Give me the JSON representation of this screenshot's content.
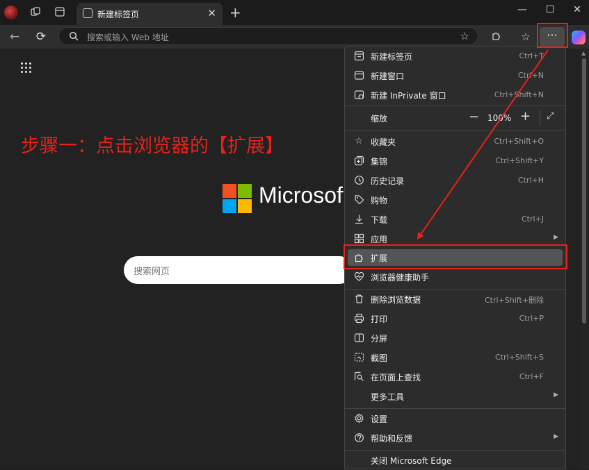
{
  "browser": {
    "tab_title": "新建标签页",
    "address_placeholder": "搜索或输入 Web 地址"
  },
  "page": {
    "annotation": "步骤一：点击浏览器的【扩展】",
    "brand": "Microsoft",
    "search_placeholder": "搜索网页"
  },
  "menu": {
    "items": [
      {
        "label": "新建标签页",
        "shortcut": "Ctrl+T",
        "icon": "new-tab-icon"
      },
      {
        "label": "新建窗口",
        "shortcut": "Ctrl+N",
        "icon": "window-icon"
      },
      {
        "label": "新建 InPrivate 窗口",
        "shortcut": "Ctrl+Shift+N",
        "icon": "inprivate-icon"
      },
      {
        "label": "缩放",
        "icon": ""
      },
      {
        "label": "收藏夹",
        "shortcut": "Ctrl+Shift+O",
        "icon": "favorites-icon"
      },
      {
        "label": "集锦",
        "shortcut": "Ctrl+Shift+Y",
        "icon": "collections-icon"
      },
      {
        "label": "历史记录",
        "shortcut": "Ctrl+H",
        "icon": "history-icon"
      },
      {
        "label": "购物",
        "icon": "shopping-tag-icon"
      },
      {
        "label": "下载",
        "shortcut": "Ctrl+J",
        "icon": "download-icon"
      },
      {
        "label": "应用",
        "icon": "apps-icon"
      },
      {
        "label": "扩展",
        "icon": "extensions-icon"
      },
      {
        "label": "浏览器健康助手",
        "icon": "health-heart-icon"
      },
      {
        "label": "删除浏览数据",
        "shortcut": "Ctrl+Shift+删除",
        "icon": "trash-icon"
      },
      {
        "label": "打印",
        "shortcut": "Ctrl+P",
        "icon": "print-icon"
      },
      {
        "label": "分屏",
        "icon": "split-screen-icon"
      },
      {
        "label": "截图",
        "shortcut": "Ctrl+Shift+S",
        "icon": "screenshot-icon"
      },
      {
        "label": "在页面上查找",
        "shortcut": "Ctrl+F",
        "icon": "find-icon"
      },
      {
        "label": "更多工具",
        "icon": ""
      },
      {
        "label": "设置",
        "icon": "gear-icon"
      },
      {
        "label": "帮助和反馈",
        "icon": "help-icon"
      },
      {
        "label": "关闭 Microsoft Edge",
        "icon": ""
      }
    ],
    "zoom_value": "100%"
  },
  "colors": {
    "annotation_red": "#e8211c",
    "ms_red": "#f25022",
    "ms_green": "#7fba00",
    "ms_blue": "#00a4ef",
    "ms_yellow": "#ffb900"
  }
}
